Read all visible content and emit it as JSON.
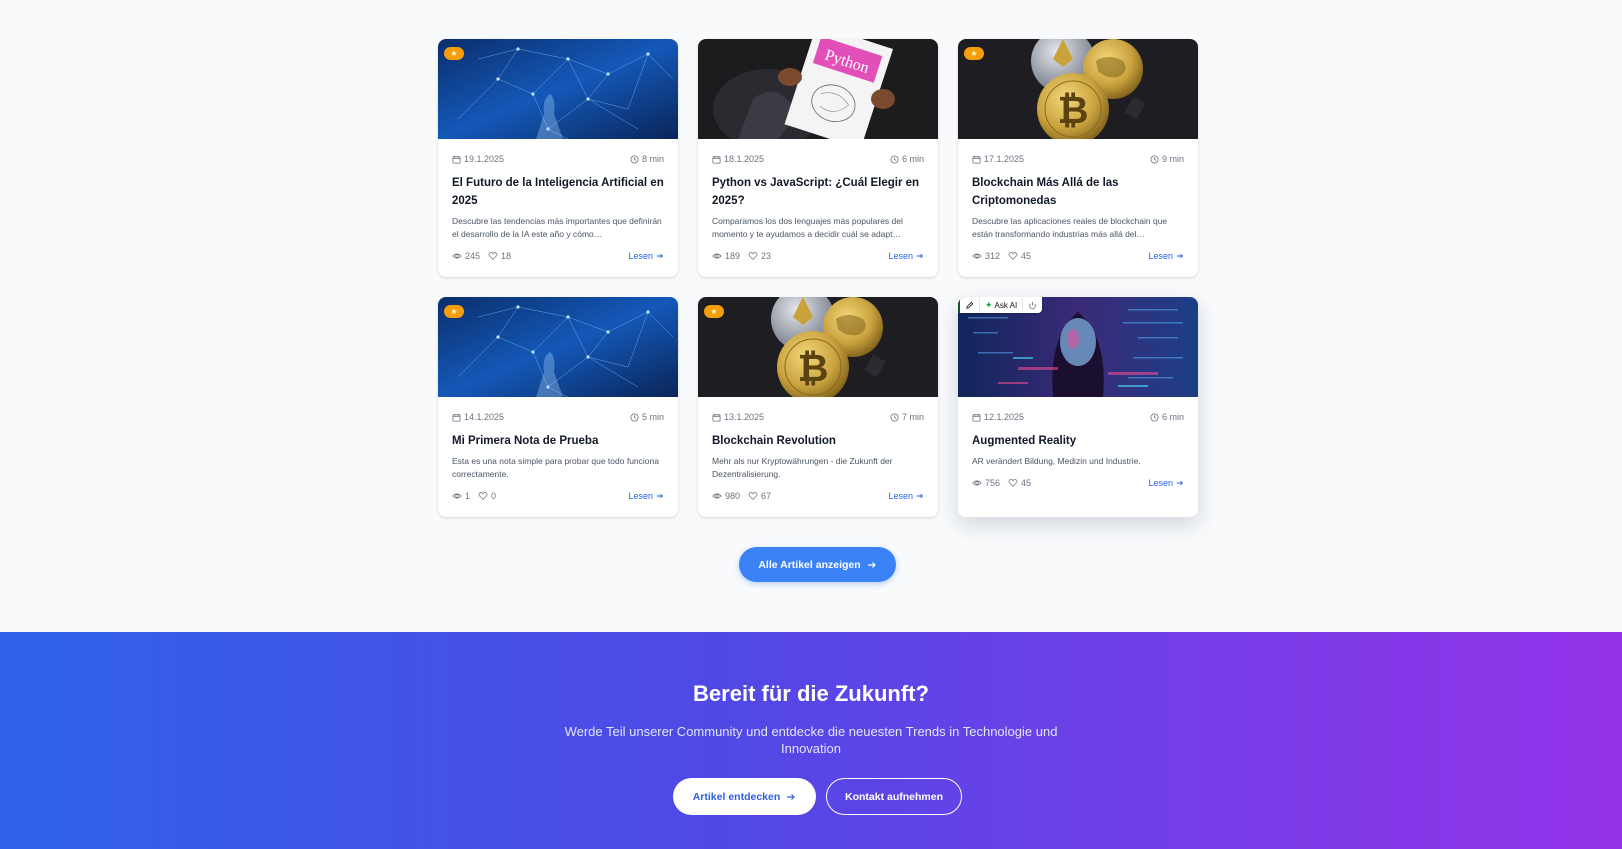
{
  "colors": {
    "accent": "#3b82f6",
    "link": "#2563eb",
    "badge": "#f59e0b",
    "gradient_start": "#2f63ea",
    "gradient_end": "#9333ea"
  },
  "articles": [
    {
      "date": "19.1.2025",
      "read_time": "8 min",
      "title": "El Futuro de la Inteligencia Artificial en 2025",
      "excerpt": "Descubre las tendencias más importantes que definirán el desarrollo de la IA este año y cómo…",
      "views": "245",
      "likes": "18",
      "read_label": "Lesen",
      "featured": true,
      "image": "ai-network"
    },
    {
      "date": "18.1.2025",
      "read_time": "6 min",
      "title": "Python vs JavaScript: ¿Cuál Elegir en 2025?",
      "excerpt": "Comparamos los dos lenguajes más populares del momento y te ayudamos a decidir cuál se adapt…",
      "views": "189",
      "likes": "23",
      "read_label": "Lesen",
      "featured": false,
      "image": "python-book",
      "book_label": "Python"
    },
    {
      "date": "17.1.2025",
      "read_time": "9 min",
      "title": "Blockchain Más Allá de las Criptomonedas",
      "excerpt": "Descubre las aplicaciones reales de blockchain que están transformando industrias más allá del…",
      "views": "312",
      "likes": "45",
      "read_label": "Lesen",
      "featured": true,
      "image": "crypto-coins"
    },
    {
      "date": "14.1.2025",
      "read_time": "5 min",
      "title": "Mi Primera Nota de Prueba",
      "excerpt": "Esta es una nota simple para probar que todo funciona correctamente.",
      "views": "1",
      "likes": "0",
      "read_label": "Lesen",
      "featured": true,
      "image": "ai-network"
    },
    {
      "date": "13.1.2025",
      "read_time": "7 min",
      "title": "Blockchain Revolution",
      "excerpt": "Mehr als nur Kryptowährungen - die Zukunft der Dezentralisierung.",
      "views": "980",
      "likes": "67",
      "read_label": "Lesen",
      "featured": true,
      "image": "crypto-coins"
    },
    {
      "date": "12.1.2025",
      "read_time": "6 min",
      "title": "Augmented Reality",
      "excerpt": "AR verändert Bildung, Medizin und Industrie.",
      "views": "756",
      "likes": "45",
      "read_label": "Lesen",
      "featured": false,
      "image": "ar-face"
    }
  ],
  "toolbar": {
    "ask_ai_label": "Ask AI"
  },
  "all_articles_button": "Alle Artikel anzeigen",
  "cta": {
    "title": "Bereit für die Zukunft?",
    "subtitle": "Werde Teil unserer Community und entdecke die neuesten Trends in Technologie und Innovation",
    "primary_button": "Artikel entdecken",
    "secondary_button": "Kontakt aufnehmen"
  }
}
